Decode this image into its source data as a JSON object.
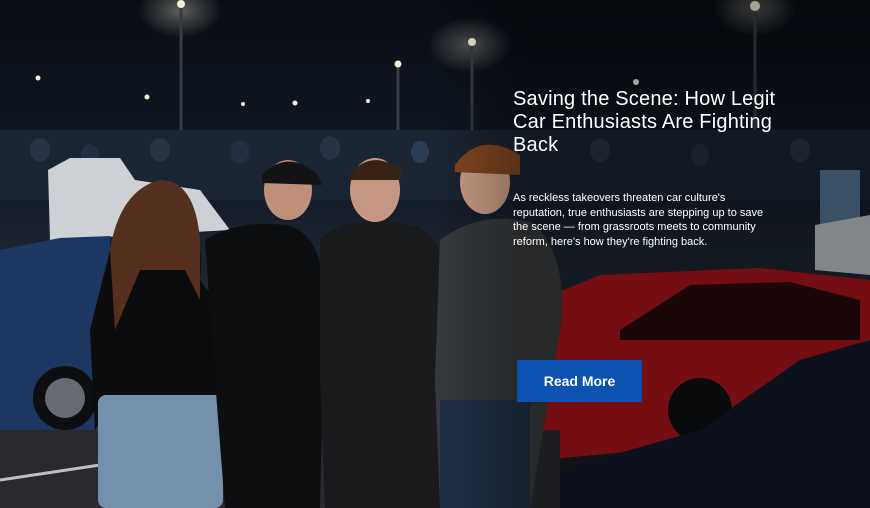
{
  "hero": {
    "title": "Saving the Scene: How Legit Car Enthusiasts Are Fighting Back",
    "description": "As reckless takeovers threaten car culture's reputation, true enthusiasts are stepping up to save the scene — from grassroots meets to community reform, here's how they're fighting back.",
    "button_label": "Read More",
    "image_subject": "four young people standing in a crowded nighttime car meet parking lot",
    "colors": {
      "button": "#0d52b0",
      "text": "#ffffff",
      "red_car": "#b3161c",
      "blue_car": "#1e3a66"
    }
  }
}
